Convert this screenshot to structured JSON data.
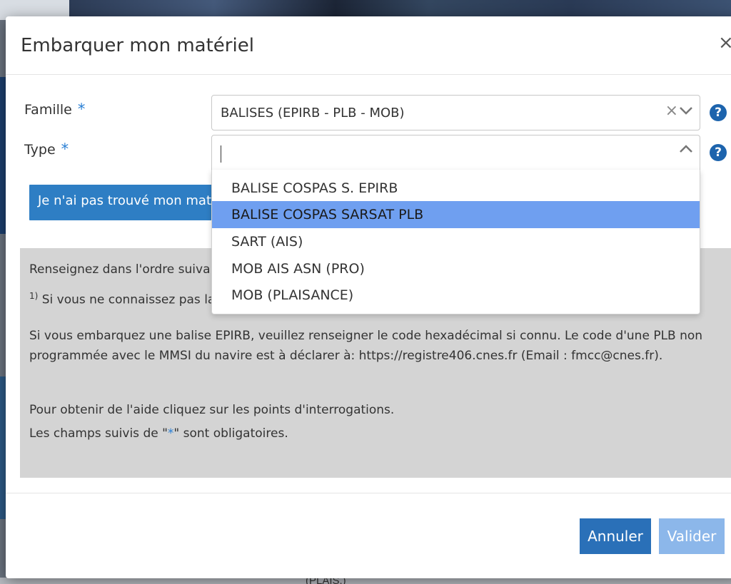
{
  "modal": {
    "title": "Embarquer mon matériel",
    "close_label": "×"
  },
  "form": {
    "famille": {
      "label": "Famille",
      "required_mark": "*",
      "value": "BALISES (EPIRB - PLB - MOB)",
      "clear_label": "×"
    },
    "type": {
      "label": "Type",
      "required_mark": "*",
      "value": ""
    },
    "help_label": "?"
  },
  "dropdown": {
    "options": [
      "BALISE COSPAS S. EPIRB",
      "BALISE COSPAS SARSAT PLB",
      "SART (AIS)",
      "MOB AIS ASN (PRO)",
      "MOB (PLAISANCE)"
    ],
    "highlighted_index": 1
  },
  "not_found_button": "Je n'ai pas trouvé mon matér",
  "info": {
    "line1": "Renseignez dans l'ordre suivar",
    "line2_sup": "1)",
    "line2": " Si vous ne connaissez pas la",
    "line3": "Si vous embarquez une balise EPIRB, veuillez renseigner le code hexadécimal si connu. Le code d'une PLB non",
    "line4": "programmée avec le MMSI du navire est à déclarer à: https://registre406.cnes.fr (Email : fmcc@cnes.fr).",
    "line5": "Pour obtenir de l'aide cliquez sur les points d'interrogations.",
    "line6_before": "Les champs suivis de \"",
    "line6_star": "*",
    "line6_after": "\" sont obligatoires."
  },
  "footer": {
    "cancel_label": "Annuler",
    "validate_label": "Valider"
  },
  "background": {
    "bottom_text": "(PLAIS.)"
  },
  "colors": {
    "primary": "#2a70b8",
    "highlight": "#6f9ff0",
    "required_star": "#2a7fd4",
    "info_bg": "#d4d4d4"
  }
}
